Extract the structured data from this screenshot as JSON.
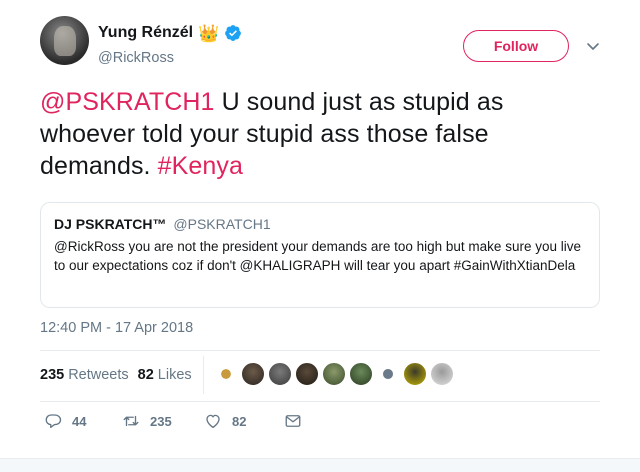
{
  "author": {
    "display_name": "Yung Rénzél",
    "handle": "@RickRoss",
    "crown_emoji": "👑",
    "verified": true
  },
  "follow_label": "Follow",
  "tweet": {
    "mention": "@PSKRATCH1",
    "text": " U sound just as stupid as whoever told your stupid ass those false demands. ",
    "hashtag": "#Kenya"
  },
  "quoted": {
    "name": "DJ PSKRATCH™",
    "handle": "@PSKRATCH1",
    "body": "@RickRoss you are not the president your demands are too high but make sure you live to our expectations coz if don't @KHALIGRAPH will tear you apart #GainWithXtianDela"
  },
  "timestamp": "12:40 PM - 17 Apr 2018",
  "stats": {
    "retweets_count": "235",
    "retweets_label": "Retweets",
    "likes_count": "82",
    "likes_label": "Likes"
  },
  "actions": {
    "replies": "44",
    "retweets": "235",
    "likes": "82"
  },
  "colors": {
    "accent": "#e0245e",
    "verified": "#1da1f2",
    "muted": "#657786"
  }
}
